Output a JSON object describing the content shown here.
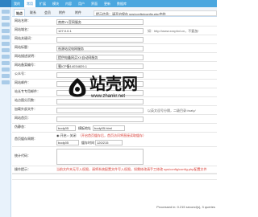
{
  "topbar": {
    "nav": [
      "我的",
      "常用",
      "扩展",
      "模块",
      "内容",
      "用户",
      "界面",
      "更新",
      "数据库"
    ],
    "active_index": 1
  },
  "tabs": {
    "items": [
      "站点",
      "联系",
      "会员",
      "附件",
      "附件"
    ],
    "active_index": 0
  },
  "notice": "提示信息：请开启保存 sys/config/config.php中的",
  "form": {
    "rows": [
      {
        "label": "网站名称：",
        "value": "商商YL官网服务"
      },
      {
        "label": "网站域名：",
        "value": "127.0.0.1",
        "hint": "如：http://www.xxxphxl.cn，不要加/"
      },
      {
        "label": "网站关键词：",
        "value": ""
      },
      {
        "label": "网站标题：",
        "value": "祝源站设电网服务"
      },
      {
        "label": "网站描述说明：",
        "value": "提供电鑫网买XX自动网服务"
      },
      {
        "label": "网站备案编号：",
        "value": "蜀ICP备14034829-1"
      },
      {
        "label": "公众号：",
        "value": ""
      },
      {
        "label": "网站邮件：",
        "value": ""
      },
      {
        "label": "站长专专用邮件：",
        "value": ""
      },
      {
        "label": "站点图分页数：",
        "value": ""
      },
      {
        "label": "加载外部文件：",
        "value": "",
        "hint": "以英文逗号分隔，二级目录:/waty/"
      },
      {
        "label": "网站首页：",
        "value": ""
      },
      {
        "label": "伪静态：",
        "value": "",
        "hint": ""
      }
    ],
    "rewrite_select": "body05",
    "rewrite_suffix_label": "模板地址",
    "rewrite_suffix_value": "body05.html",
    "cache_label": "首页缓存周期：",
    "cache_on_label": "开启",
    "cache_off_label": "关闭",
    "cache_hint": "（开启首页缓存后，首页访问将直接读取缓存）",
    "cache_select": "body05",
    "cache_time_label": "缓存时间",
    "cache_time_value": "120/215",
    "stats_label": "统计代码：",
    "stats_value": "",
    "tip_label": "操作提示：",
    "tip_text": "当前文件夹无写入权限，请将系统配置文件写入权限，如需修改请手工修改 sys/config/config.php配置文件"
  },
  "watermark": {
    "title": "站壳网",
    "subtitle": "www.zhankr.net"
  },
  "footer": "Processed in: 0.215 second(s), 3 queries"
}
